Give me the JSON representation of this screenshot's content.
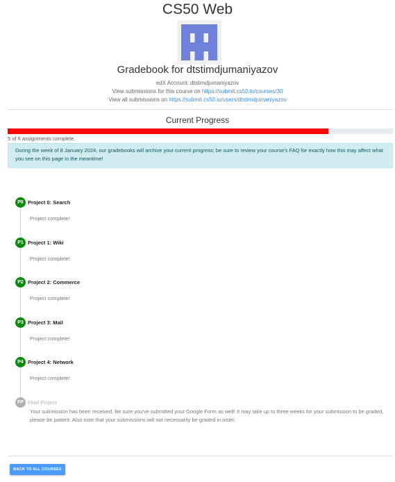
{
  "header": {
    "title": "CS50 Web",
    "avatar_icon": "identicon-avatar",
    "gradebook_title": "Gradebook for dtstimdjumaniyazov",
    "edx_account": "edX Account: dtstimdjumaniyazov",
    "course_submissions_prefix": "View submissions for this course on ",
    "course_submissions_link": "https://submit.cs50.io/courses/30",
    "all_submissions_prefix": "View all submissions on ",
    "all_submissions_link": "https://submit.cs50.io/users/dtstimdjumaniyazov"
  },
  "progress": {
    "title": "Current Progress",
    "completed": 5,
    "total": 6,
    "fraction": 0.833,
    "summary": "5 of 6 assignments complete.",
    "bar_color": "#ff0000"
  },
  "notice": "During the week of 8 January 2024, our gradebooks will archive your current progress; be sure to review your course's FAQ for exactly how this may affect what you see on this page in the meantime!",
  "projects": [
    {
      "badge": "P0",
      "title": "Project 0: Search",
      "status": "Project complete!",
      "complete": true
    },
    {
      "badge": "P1",
      "title": "Project 1: Wiki",
      "status": "Project complete!",
      "complete": true
    },
    {
      "badge": "P2",
      "title": "Project 2: Commerce",
      "status": "Project complete!",
      "complete": true
    },
    {
      "badge": "P3",
      "title": "Project 3: Mail",
      "status": "Project complete!",
      "complete": true
    },
    {
      "badge": "P4",
      "title": "Project 4: Network",
      "status": "Project complete!",
      "complete": true
    },
    {
      "badge": "FP",
      "title": "Final Project",
      "status": "Your submission has been received. Be sure you've submitted your Google Form as well! It may take up to three weeks for your submission to be graded, please be patient. Also note that your submissions will not necessarily be graded in order.",
      "complete": false
    }
  ],
  "colors": {
    "complete_badge": "#0a8a0a",
    "pending_badge": "#b0b0b0",
    "link": "#3a8bd6",
    "button": "#4a9cff",
    "alert_bg": "#d1ecf1"
  },
  "footer": {
    "back_button": "BACK TO ALL COURSES"
  }
}
